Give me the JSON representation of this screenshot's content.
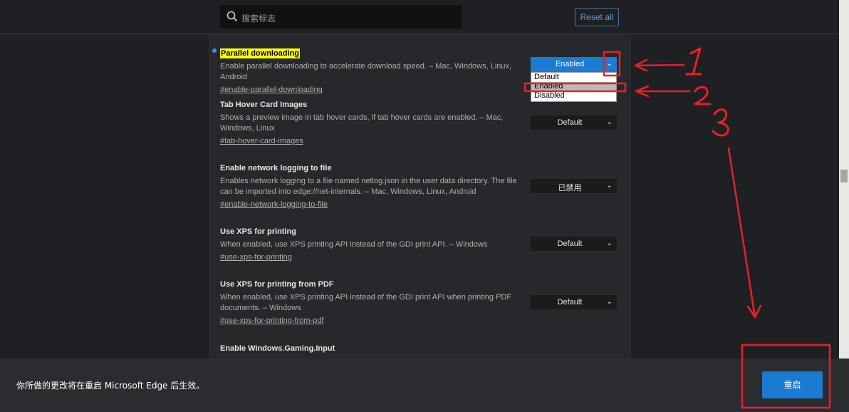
{
  "header": {
    "search_placeholder": "搜索标志",
    "reset_label": "Reset all"
  },
  "flags": [
    {
      "title": "Parallel downloading",
      "description": "Enable parallel downloading to accelerate download speed. – Mac, Windows, Linux, Android",
      "anchor": "#enable-parallel-downloading",
      "value": "Enabled",
      "highlighted": true
    },
    {
      "title": "Tab Hover Card Images",
      "description": "Shows a preview image in tab hover cards, if tab hover cards are enabled. – Mac, Windows, Linux",
      "anchor": "#tab-hover-card-images",
      "value": "Default"
    },
    {
      "title": "Enable network logging to file",
      "description": "Enables network logging to a file named netlog.json in the user data directory. The file can be imported into edge://net-internals. – Mac, Windows, Linux, Android",
      "anchor": "#enable-network-logging-to-file",
      "value": "已禁用"
    },
    {
      "title": "Use XPS for printing",
      "description": "When enabled, use XPS printing API instead of the GDI print API. – Windows",
      "anchor": "#use-xps-for-printing",
      "value": "Default"
    },
    {
      "title": "Use XPS for printing from PDF",
      "description": "When enabled, use XPS printing API instead of the GDI print API when printing PDF documents. – Windows",
      "anchor": "#use-xps-for-printing-from-pdf",
      "value": "Default"
    },
    {
      "title": "Enable Windows.Gaming.Input"
    }
  ],
  "dropdown": {
    "options": [
      "Default",
      "Enabled",
      "Disabled"
    ],
    "selected": "Enabled"
  },
  "annotations": {
    "labels": [
      "1",
      "2",
      "3"
    ],
    "color": "#e8202a"
  },
  "footer": {
    "message": "你所做的更改将在重启 Microsoft Edge 后生效。",
    "restart_label": "重启"
  },
  "colors": {
    "background": "#1f2023",
    "panel": "#27282b",
    "accent": "#1b7ad1",
    "highlight": "#ffff00"
  }
}
